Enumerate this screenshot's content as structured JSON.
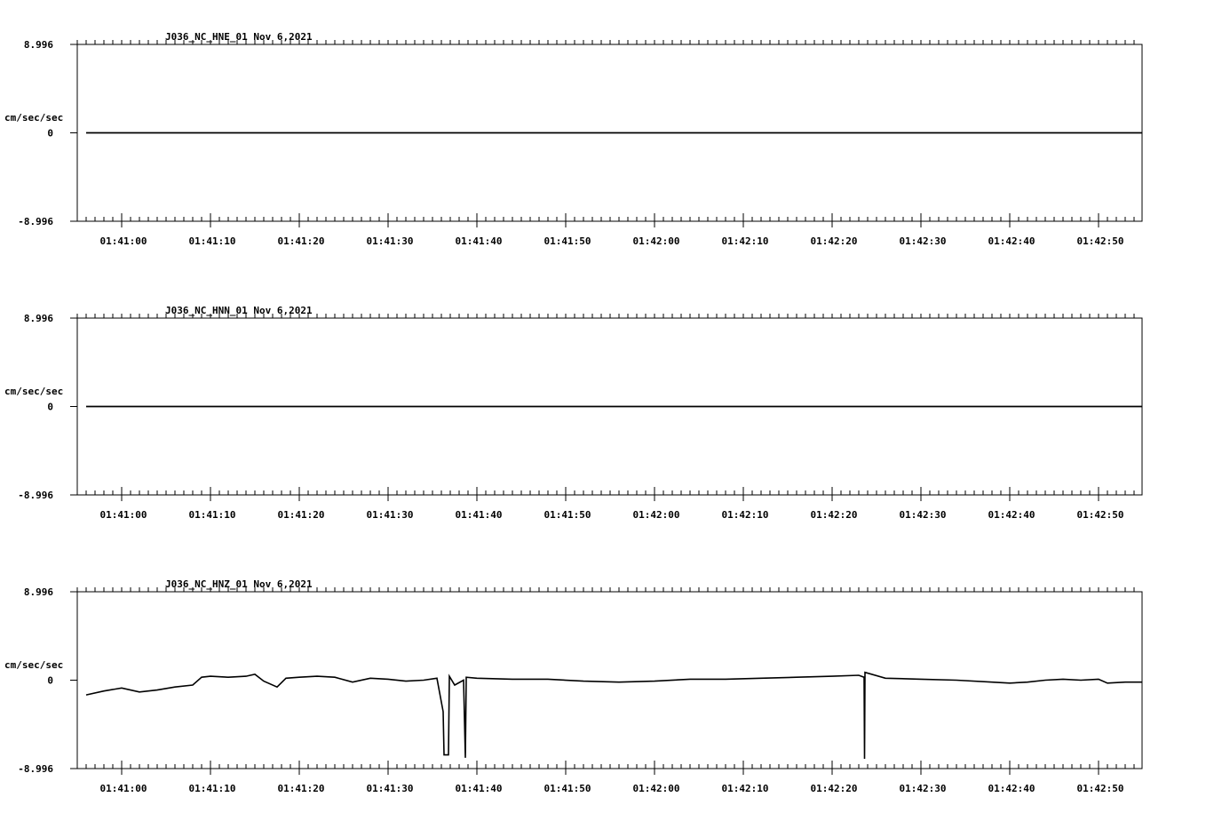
{
  "chart_data": [
    {
      "type": "line",
      "title": "J036_NC_HNE_01   Nov 6,2021",
      "ylabel": "cm/sec/sec",
      "ylim": [
        -8.996,
        8.996
      ],
      "ytick_labels": [
        "8.996",
        "0",
        "-8.996"
      ],
      "xtick_labels": [
        "01:41:00",
        "01:41:10",
        "01:41:20",
        "01:41:30",
        "01:41:40",
        "01:41:50",
        "01:42:00",
        "01:42:10",
        "01:42:20",
        "01:42:30",
        "01:42:40",
        "01:42:50"
      ],
      "series": [
        {
          "values": [
            [
              -4.0,
              0.0
            ],
            [
              114.9,
              0.0
            ]
          ]
        }
      ]
    },
    {
      "type": "line",
      "title": "J036_NC_HNN_01   Nov 6,2021",
      "ylabel": "cm/sec/sec",
      "ylim": [
        -8.996,
        8.996
      ],
      "ytick_labels": [
        "8.996",
        "0",
        "-8.996"
      ],
      "xtick_labels": [
        "01:41:00",
        "01:41:10",
        "01:41:20",
        "01:41:30",
        "01:41:40",
        "01:41:50",
        "01:42:00",
        "01:42:10",
        "01:42:20",
        "01:42:30",
        "01:42:40",
        "01:42:50"
      ],
      "series": [
        {
          "values": [
            [
              -4.0,
              0.0
            ],
            [
              114.9,
              0.0
            ]
          ]
        }
      ]
    },
    {
      "type": "line",
      "title": "J036_NC_HNZ_01   Nov 6,2021",
      "ylabel": "cm/sec/sec",
      "ylim": [
        -8.996,
        8.996
      ],
      "ytick_labels": [
        "8.996",
        "0",
        "-8.996"
      ],
      "xtick_labels": [
        "01:41:00",
        "01:41:10",
        "01:41:20",
        "01:41:30",
        "01:41:40",
        "01:41:50",
        "01:42:00",
        "01:42:10",
        "01:42:20",
        "01:42:30",
        "01:42:40",
        "01:42:50"
      ],
      "series": [
        {
          "values": [
            [
              -4.0,
              -1.5
            ],
            [
              -2.0,
              -1.1
            ],
            [
              0.0,
              -0.8
            ],
            [
              2.0,
              -1.2
            ],
            [
              4.0,
              -1.0
            ],
            [
              6.0,
              -0.7
            ],
            [
              8.0,
              -0.5
            ],
            [
              9.0,
              0.3
            ],
            [
              10.0,
              0.4
            ],
            [
              12.0,
              0.3
            ],
            [
              14.0,
              0.4
            ],
            [
              15.0,
              0.6
            ],
            [
              16.0,
              -0.1
            ],
            [
              17.5,
              -0.7
            ],
            [
              18.5,
              0.2
            ],
            [
              20.0,
              0.3
            ],
            [
              22.0,
              0.4
            ],
            [
              24.0,
              0.3
            ],
            [
              26.0,
              -0.2
            ],
            [
              28.0,
              0.2
            ],
            [
              30.0,
              0.1
            ],
            [
              32.0,
              -0.1
            ],
            [
              34.0,
              0.0
            ],
            [
              35.5,
              0.2
            ],
            [
              36.2,
              -3.2
            ],
            [
              36.3,
              -7.6
            ],
            [
              36.8,
              -7.6
            ],
            [
              36.9,
              0.4
            ],
            [
              37.5,
              -0.5
            ],
            [
              38.5,
              0.0
            ],
            [
              38.7,
              -7.9
            ],
            [
              38.8,
              0.3
            ],
            [
              40.0,
              0.2
            ],
            [
              44.0,
              0.1
            ],
            [
              48.0,
              0.1
            ],
            [
              52.0,
              -0.1
            ],
            [
              56.0,
              -0.2
            ],
            [
              60.0,
              -0.1
            ],
            [
              64.0,
              0.1
            ],
            [
              68.0,
              0.1
            ],
            [
              72.0,
              0.2
            ],
            [
              76.0,
              0.3
            ],
            [
              80.0,
              0.4
            ],
            [
              83.0,
              0.5
            ],
            [
              83.6,
              0.3
            ],
            [
              83.65,
              -8.0
            ],
            [
              83.7,
              0.8
            ],
            [
              86.0,
              0.2
            ],
            [
              90.0,
              0.1
            ],
            [
              94.0,
              0.0
            ],
            [
              98.0,
              -0.2
            ],
            [
              100.0,
              -0.3
            ],
            [
              102.0,
              -0.2
            ],
            [
              104.0,
              0.0
            ],
            [
              106.0,
              0.1
            ],
            [
              108.0,
              0.0
            ],
            [
              110.0,
              0.1
            ],
            [
              111.0,
              -0.3
            ],
            [
              113.0,
              -0.2
            ],
            [
              114.9,
              -0.2
            ]
          ]
        }
      ]
    }
  ],
  "colors": {
    "line": "#000000",
    "background": "#ffffff"
  }
}
